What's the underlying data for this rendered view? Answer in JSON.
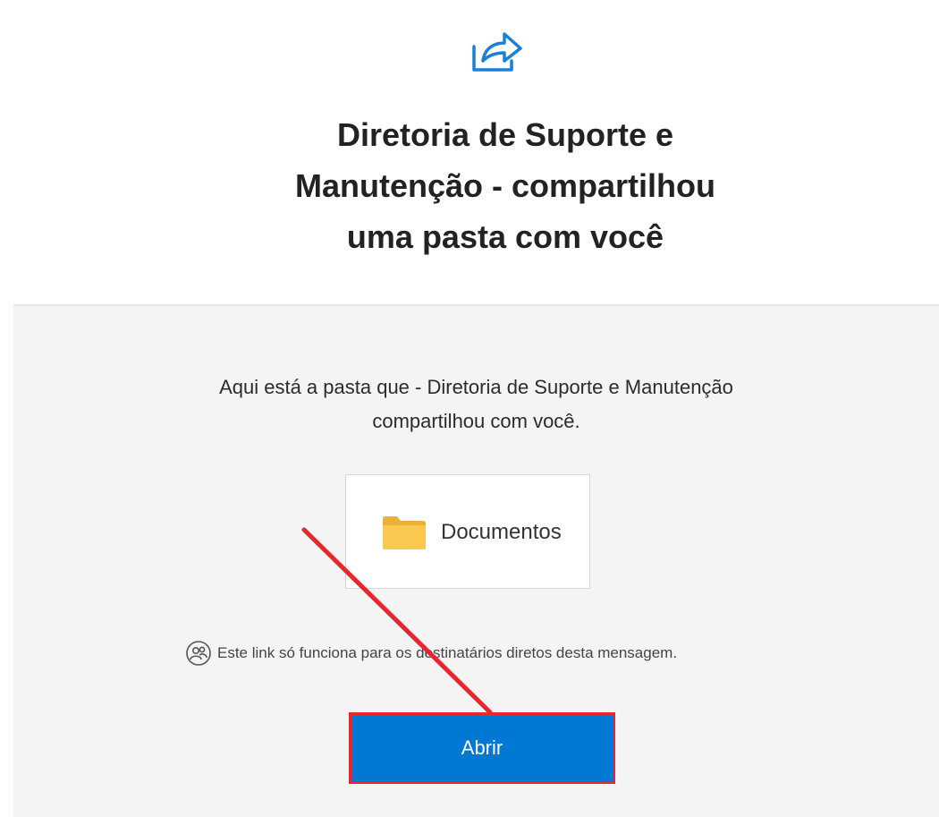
{
  "header": {
    "icon": "share-icon",
    "title_lines": [
      "Diretoria de Suporte e",
      "Manutenção - compartilhou",
      "uma pasta com você"
    ]
  },
  "body": {
    "message_lines": [
      "Aqui está a pasta que - Diretoria de Suporte e Manutenção",
      "compartilhou com você."
    ],
    "folder": {
      "icon": "folder-icon",
      "name": "Documentos"
    },
    "notice": {
      "icon": "people-icon",
      "text": "Este link só funciona para os destinatários diretos desta mensagem."
    },
    "open_button": {
      "label": "Abrir"
    }
  },
  "annotation": {
    "type": "red-arrow",
    "color": "#e8262e",
    "target": "open-button"
  },
  "colors": {
    "accent": "#0078d4",
    "annotation": "#e8262e",
    "folder": "#f6c244"
  }
}
